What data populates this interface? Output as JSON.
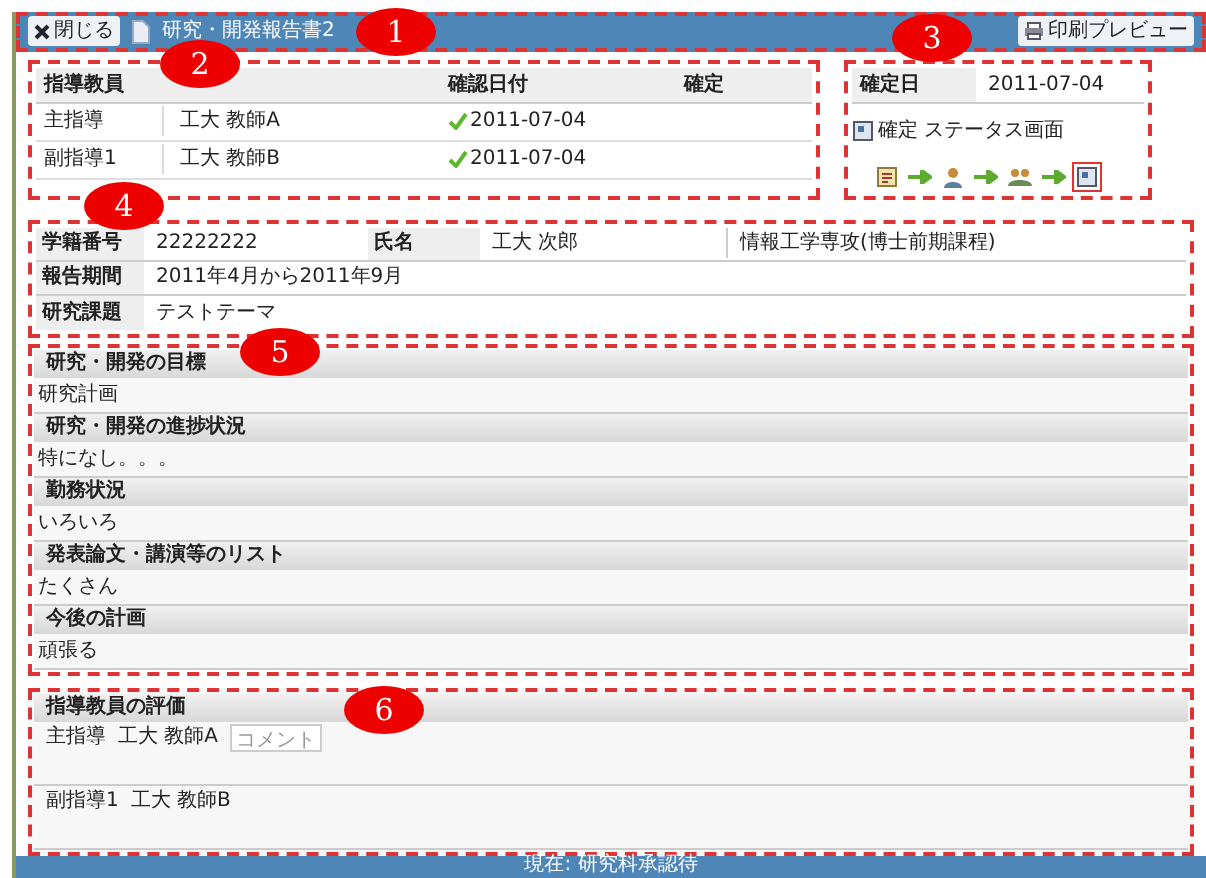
{
  "header": {
    "close_button": "閉じる",
    "title": "研究・開発報告書2",
    "preview_button": "印刷プレビュー"
  },
  "annotations": [
    "1",
    "2",
    "3",
    "4",
    "5",
    "6"
  ],
  "advisors": {
    "columns": [
      "指導教員",
      "確認日付",
      "確定"
    ],
    "rows": [
      {
        "role": "主指導",
        "name": "工大 教師A",
        "date": "2011-07-04",
        "confirmed": true
      },
      {
        "role": "副指導1",
        "name": "工大 教師B",
        "date": "2011-07-04",
        "confirmed": true
      }
    ]
  },
  "status": {
    "label": "確定日",
    "date": "2011-07-04",
    "link": "確定 ステータス画面",
    "steps": [
      {
        "kind": "form",
        "selected": false
      },
      {
        "kind": "person",
        "selected": false
      },
      {
        "kind": "group",
        "selected": false
      },
      {
        "kind": "screen",
        "selected": true
      }
    ]
  },
  "student": {
    "id_label": "学籍番号",
    "id": "22222222",
    "name_label": "氏名",
    "name": "工大 次郎",
    "course": "情報工学専攻(博士前期課程)",
    "period_label": "報告期間",
    "period": "2011年4月から2011年9月",
    "topic_label": "研究課題",
    "topic": "テストテーマ"
  },
  "sections": [
    {
      "heading": "研究・開発の目標",
      "body": "研究計画"
    },
    {
      "heading": "研究・開発の進捗状況",
      "body": "特になし。。。"
    },
    {
      "heading": "勤務状況",
      "body": "いろいろ"
    },
    {
      "heading": "発表論文・講演等のリスト",
      "body": "たくさん"
    },
    {
      "heading": "今後の計画",
      "body": "頑張る"
    }
  ],
  "evaluation": {
    "heading": "指導教員の評価",
    "rows": [
      {
        "role": "主指導",
        "name": "工大 教師A",
        "comment_button": "コメント",
        "disabled": true
      },
      {
        "role": "副指導1",
        "name": "工大 教師B"
      }
    ]
  },
  "footer": "現在: 研究科承認待"
}
